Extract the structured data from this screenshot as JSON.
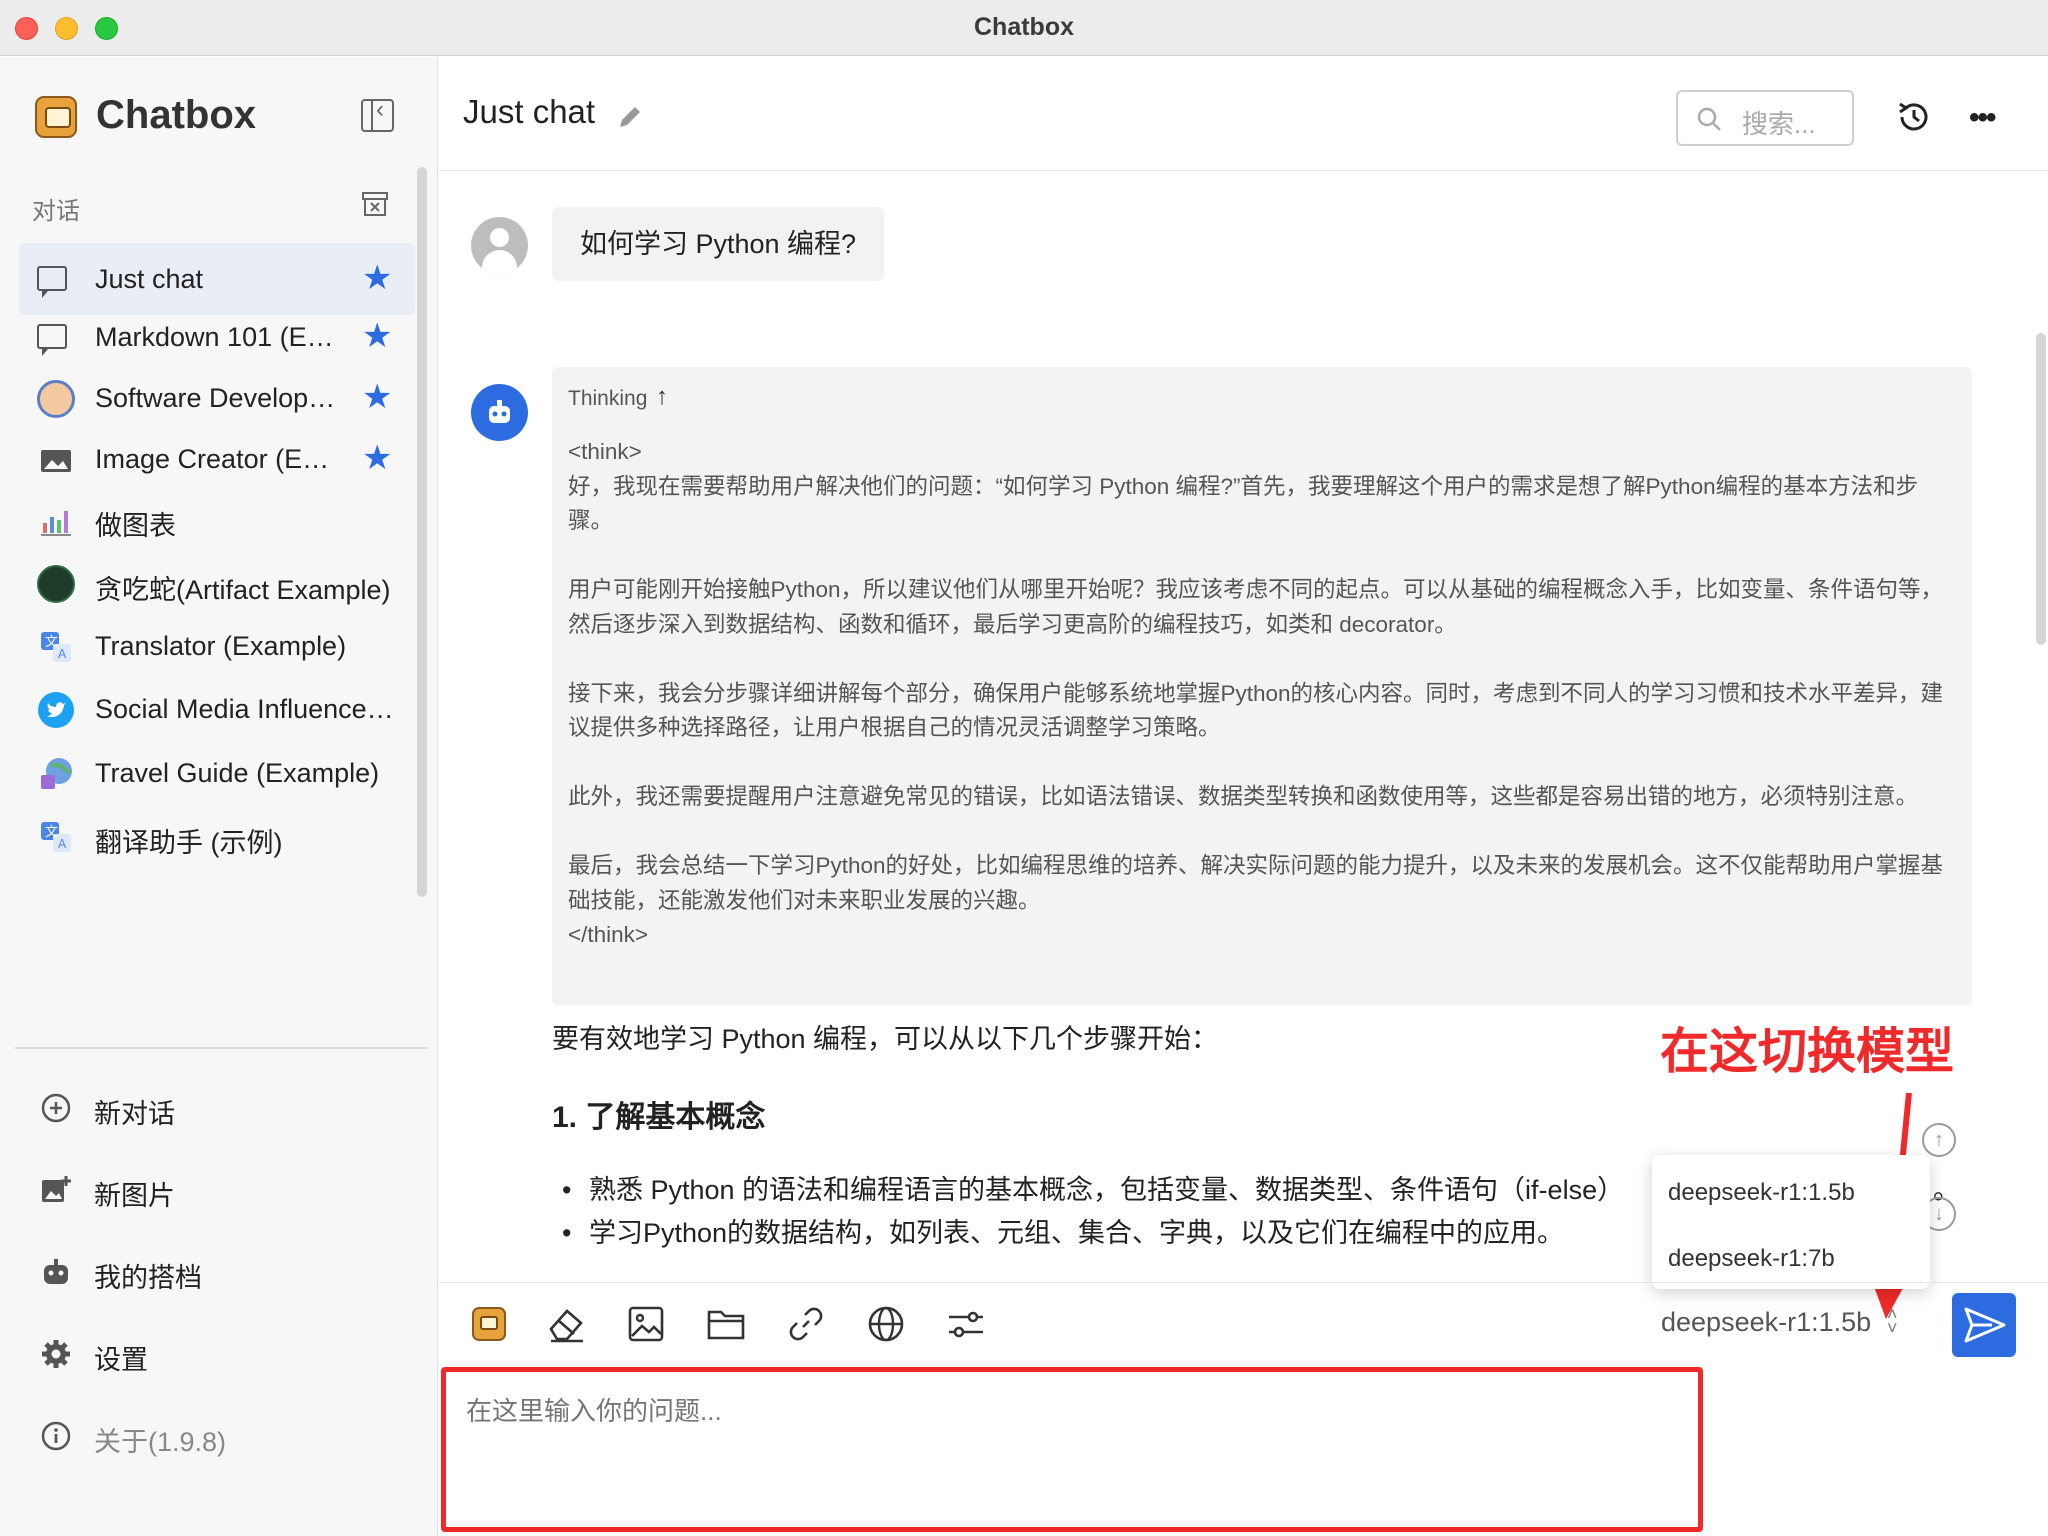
{
  "window": {
    "title": "Chatbox"
  },
  "sidebar": {
    "brand": "Chatbox",
    "section_label": "对话",
    "sessions": [
      {
        "label": "Just chat",
        "starred": true,
        "active": true,
        "icon": "chat-bubble-icon"
      },
      {
        "label": "Markdown 101 (E…",
        "starred": true,
        "icon": "chat-bubble-icon"
      },
      {
        "label": "Software Develop…",
        "starred": true,
        "icon": "developer-avatar-icon"
      },
      {
        "label": "Image Creator (E…",
        "starred": true,
        "icon": "image-icon"
      },
      {
        "label": "做图表",
        "starred": false,
        "icon": "chart-icon"
      },
      {
        "label": "贪吃蛇(Artifact Example)",
        "starred": false,
        "icon": "snake-game-icon"
      },
      {
        "label": "Translator (Example)",
        "starred": false,
        "icon": "translate-icon"
      },
      {
        "label": "Social Media Influence…",
        "starred": false,
        "icon": "twitter-icon"
      },
      {
        "label": "Travel Guide (Example)",
        "starred": false,
        "icon": "globe-travel-icon"
      },
      {
        "label": "翻译助手 (示例)",
        "starred": false,
        "icon": "translate-icon"
      }
    ],
    "menu": [
      {
        "label": "新对话",
        "icon": "plus-circle-icon"
      },
      {
        "label": "新图片",
        "icon": "add-image-icon"
      },
      {
        "label": "我的搭档",
        "icon": "robot-icon"
      },
      {
        "label": "设置",
        "icon": "gear-icon"
      },
      {
        "label": "关于(1.9.8)",
        "icon": "info-icon"
      }
    ]
  },
  "header": {
    "title": "Just chat",
    "search_placeholder": "搜索..."
  },
  "messages": {
    "user": "如何学习 Python 编程?",
    "thinking_label": "Thinking",
    "thinking_paragraphs": [
      "<think>\n好，我现在需要帮助用户解决他们的问题：“如何学习 Python 编程?”首先，我要理解这个用户的需求是想了解Python编程的基本方法和步骤。",
      "用户可能刚开始接触Python，所以建议他们从哪里开始呢？我应该考虑不同的起点。可以从基础的编程概念入手，比如变量、条件语句等，然后逐步深入到数据结构、函数和循环，最后学习更高阶的编程技巧，如类和 decorator。",
      "接下来，我会分步骤详细讲解每个部分，确保用户能够系统地掌握Python的核心内容。同时，考虑到不同人的学习习惯和技术水平差异，建议提供多种选择路径，让用户根据自己的情况灵活调整学习策略。",
      "此外，我还需要提醒用户注意避免常见的错误，比如语法错误、数据类型转换和函数使用等，这些都是容易出错的地方，必须特别注意。",
      "最后，我会总结一下学习Python的好处，比如编程思维的培养、解决实际问题的能力提升，以及未来的发展机会。这不仅能帮助用户掌握基础技能，还能激发他们对未来职业发展的兴趣。\n</think>"
    ],
    "answer_intro": "要有效地学习 Python 编程，可以从以下几个步骤开始：",
    "answer_heading": "1. 了解基本概念",
    "answer_bullets": [
      "熟悉 Python 的语法和编程语言的基本概念，包括变量、数据类型、条件语句（if-else）",
      "学习Python的数据结构，如列表、元组、集合、字典，以及它们在编程中的应用。"
    ],
    "answer_overflow_tail": "。"
  },
  "annotation": {
    "text": "在这切换模型",
    "color": "#f02a2a"
  },
  "model_dropdown": {
    "options": [
      "deepseek-r1:1.5b",
      "deepseek-r1:7b"
    ],
    "selected": "deepseek-r1:1.5b"
  },
  "input": {
    "placeholder": "在这里输入你的问题..."
  },
  "colors": {
    "accent": "#2d6be0",
    "annotation": "#f02a2a"
  }
}
